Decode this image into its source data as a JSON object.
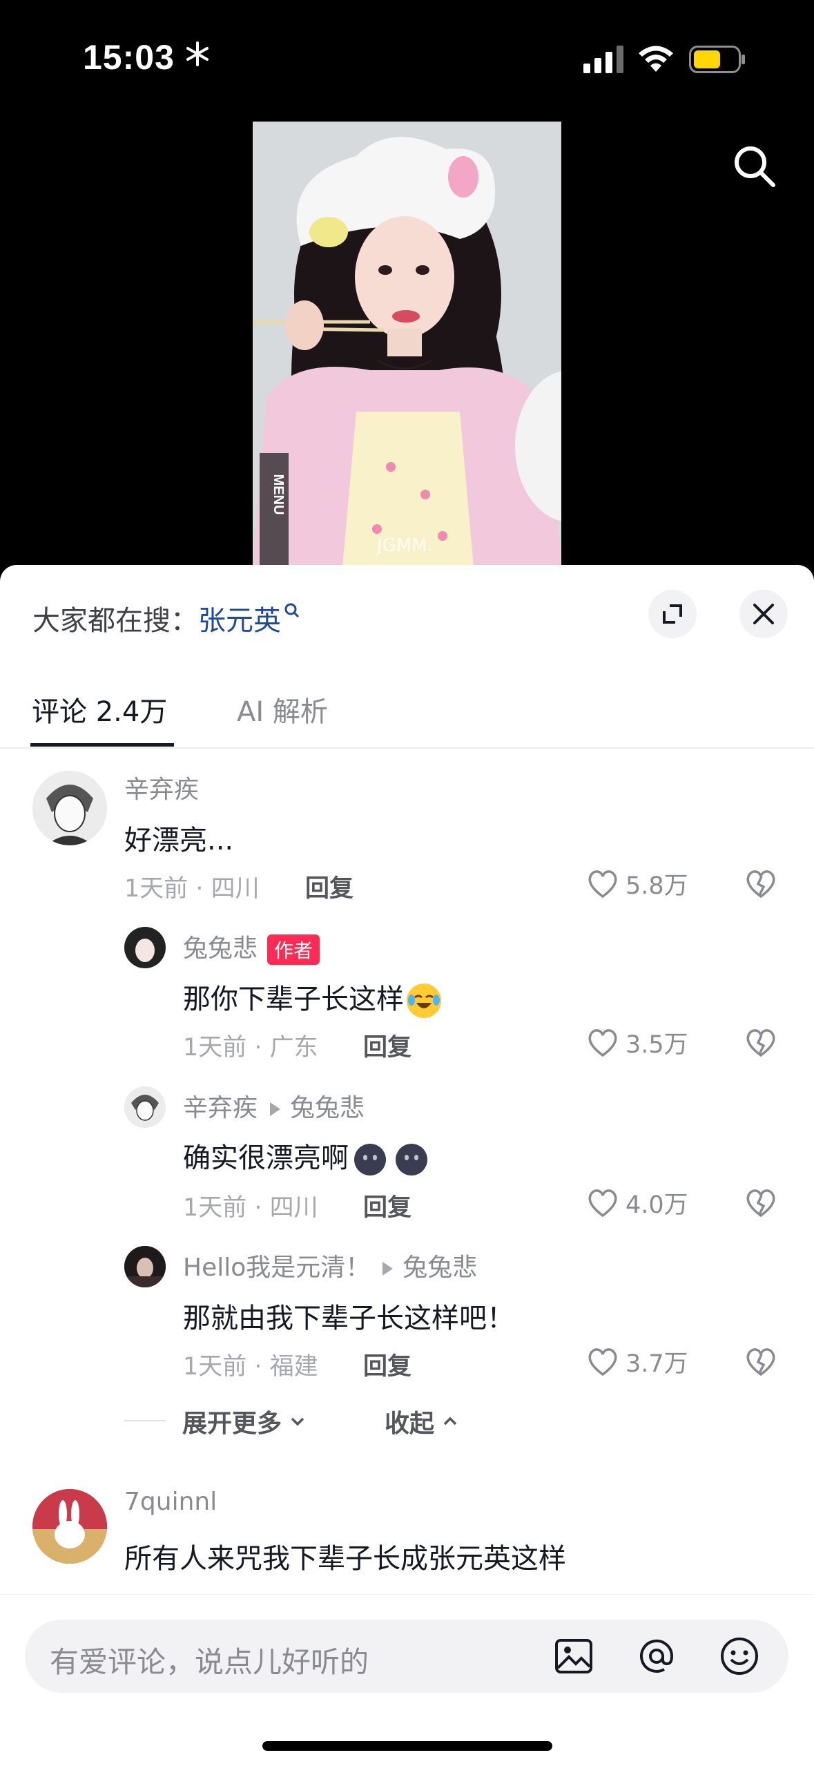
{
  "status_bar": {
    "time": "15:03"
  },
  "search_hint": {
    "prefix": "大家都在搜：",
    "keyword": "张元英"
  },
  "video": {
    "overlay_text": "JGMM."
  },
  "tabs": [
    {
      "label": "评论 2.4万",
      "active": true
    },
    {
      "label": "AI 解析",
      "active": false
    }
  ],
  "comments": [
    {
      "user": "辛弃疾",
      "text": "好漂亮...",
      "time": "1天前 · 四川",
      "reply": "回复",
      "likes": "5.8万"
    },
    {
      "user": "兔兔悲",
      "tag": "作者",
      "text": "那你下辈子长这样",
      "time": "1天前 · 广东",
      "reply": "回复",
      "likes": "3.5万"
    },
    {
      "user": "辛弃疾",
      "reply_to": "兔兔悲",
      "text": "确实很漂亮啊",
      "time": "1天前 · 四川",
      "reply": "回复",
      "likes": "4.0万"
    },
    {
      "user": "Hello我是元清！",
      "reply_to": "兔兔悲",
      "text": "那就由我下辈子长这样吧！",
      "time": "1天前 · 福建",
      "reply": "回复",
      "likes": "3.7万"
    },
    {
      "user": "7quinnl",
      "text": "所有人来咒我下辈子长成张元英这样"
    }
  ],
  "thread_controls": {
    "expand": "展开更多",
    "collapse": "收起"
  },
  "input": {
    "placeholder": "有爱评论，说点儿好听的"
  },
  "colors": {
    "author_tag": "#fe2c55",
    "keyword": "#1f4a9b",
    "battery": "#ffd60a"
  }
}
